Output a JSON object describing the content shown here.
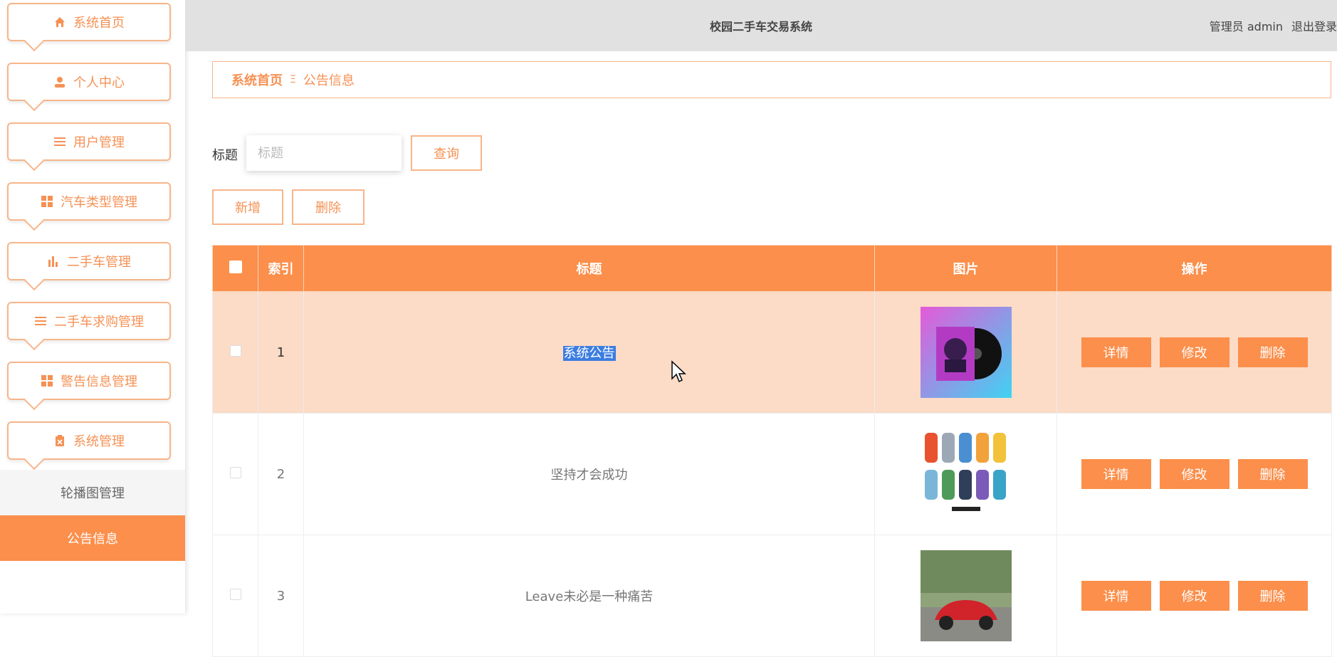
{
  "header": {
    "title": "校园二手车交易系统",
    "user": "管理员 admin",
    "logout": "退出登录"
  },
  "sidebar": {
    "items": [
      {
        "label": "系统首页",
        "icon": "home-icon"
      },
      {
        "label": "个人中心",
        "icon": "user-icon"
      },
      {
        "label": "用户管理",
        "icon": "list-icon"
      },
      {
        "label": "汽车类型管理",
        "icon": "grid-icon"
      },
      {
        "label": "二手车管理",
        "icon": "bar-chart-icon"
      },
      {
        "label": "二手车求购管理",
        "icon": "list-icon"
      },
      {
        "label": "警告信息管理",
        "icon": "grid-icon"
      },
      {
        "label": "系统管理",
        "icon": "clipboard-icon"
      }
    ],
    "submenu": [
      {
        "label": "轮播图管理"
      },
      {
        "label": "公告信息",
        "active": true
      }
    ]
  },
  "breadcrumb": {
    "home": "系统首页",
    "separator": "Ξ",
    "current": "公告信息"
  },
  "search": {
    "label": "标题",
    "placeholder": "标题",
    "value": "",
    "button": "查询"
  },
  "actions": {
    "add": "新增",
    "delete": "删除"
  },
  "table": {
    "headers": {
      "index": "索引",
      "title": "标题",
      "image": "图片",
      "ops": "操作"
    },
    "rows": [
      {
        "index": "1",
        "title": "系统公告",
        "image": "album-cover-image",
        "selected": true
      },
      {
        "index": "2",
        "title": "坚持才会成功",
        "image": "city-cars-image",
        "selected": false
      },
      {
        "index": "3",
        "title": "Leave未必是一种痛苦",
        "image": "red-car-image",
        "selected": false
      }
    ],
    "op_labels": {
      "detail": "详情",
      "edit": "修改",
      "delete": "删除"
    }
  },
  "colors": {
    "accent": "#fb8f4b",
    "accent_light": "#f7b58a",
    "row_selected": "#fcdbc7",
    "header_bg": "#e2e1e2"
  }
}
